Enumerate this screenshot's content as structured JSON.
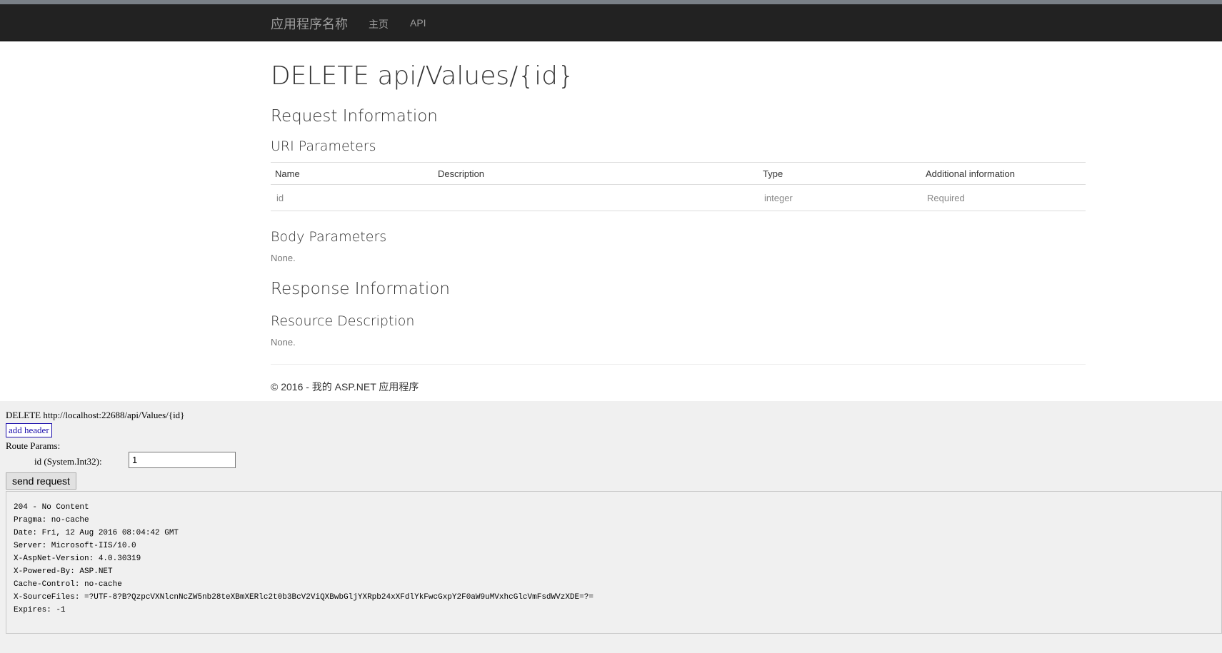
{
  "navbar": {
    "brand": "应用程序名称",
    "links": [
      "主页",
      "API"
    ]
  },
  "page": {
    "title": "DELETE api/Values/{id}",
    "request_info": "Request Information",
    "uri_params": "URI Parameters",
    "table": {
      "headers": [
        "Name",
        "Description",
        "Type",
        "Additional information"
      ],
      "rows": [
        {
          "name": "id",
          "description": "",
          "type": "integer",
          "info": "Required"
        }
      ]
    },
    "body_params": "Body Parameters",
    "body_none": "None.",
    "response_info": "Response Information",
    "resource_desc": "Resource Description",
    "resource_none": "None.",
    "footer": "© 2016 - 我的 ASP.NET 应用程序"
  },
  "tester": {
    "request_line": "DELETE http://localhost:22688/api/Values/{id}",
    "add_header": "add header",
    "route_params": "Route Params:",
    "id_label": "id (System.Int32):",
    "id_value": "1",
    "send_button": "send request",
    "response_lines": [
      "204 - No Content",
      "Pragma: no-cache",
      "Date: Fri, 12 Aug 2016 08:04:42 GMT",
      "Server: Microsoft-IIS/10.0",
      "X-AspNet-Version: 4.0.30319",
      "X-Powered-By: ASP.NET",
      "Cache-Control: no-cache",
      "X-SourceFiles: =?UTF-8?B?QzpcVXNlcnNcZW5nb28teXBmXERlc2t0b3BcV2ViQXBwbGljYXRpb24xXFdlYkFwcGxpY2F0aW9uMVxhcGlcVmFsdWVzXDE=?=",
      "Expires: -1"
    ]
  }
}
